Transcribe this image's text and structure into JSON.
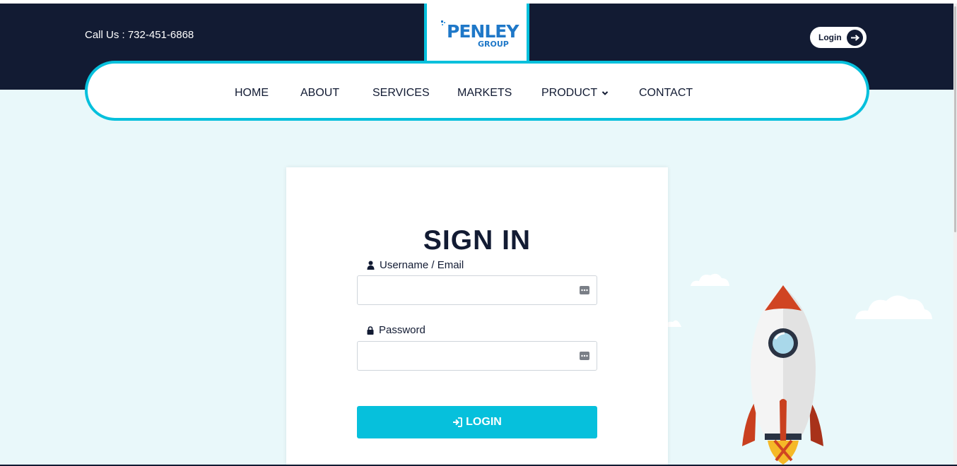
{
  "header": {
    "phone_text": "Call Us : 732-451-6868",
    "logo": {
      "main": "PENLEY",
      "sub": "GROUP"
    },
    "login_label": "Login",
    "colors": {
      "dark": "#121b33",
      "accent": "#06c0dc",
      "logo_blue": "#1f78c8"
    }
  },
  "nav": {
    "items": [
      {
        "label": "HOME"
      },
      {
        "label": "ABOUT"
      },
      {
        "label": "SERVICES"
      },
      {
        "label": "MARKETS"
      },
      {
        "label": "PRODUCT",
        "icon": "chevron-down-icon"
      },
      {
        "label": "CONTACT"
      }
    ]
  },
  "signin": {
    "title": "SIGN IN",
    "username_label": "Username / Email",
    "username_value": "",
    "password_label": "Password",
    "password_value": "",
    "login_button": "LOGIN"
  }
}
